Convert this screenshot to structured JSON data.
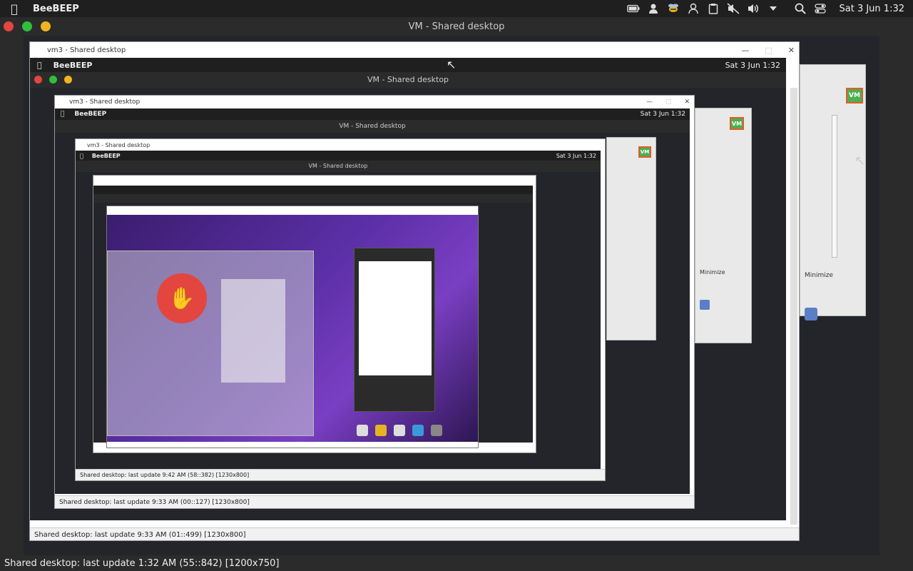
{
  "menubar": {
    "app_name": "BeeBEEP",
    "clock": "Sat 3 Jun 1:32",
    "tray_icons": [
      "battery-icon",
      "user-icon",
      "beebeep-icon",
      "users-icon",
      "clipboard-icon",
      "mute-icon",
      "volume-icon",
      "dropdown-icon",
      "search-icon",
      "toggle-icon"
    ]
  },
  "window": {
    "title": "VM - Shared desktop"
  },
  "level1": {
    "title": "vm3 - Shared desktop",
    "app_name": "BeeBEEP",
    "clock": "Sat 3 Jun 1:32",
    "inner_title": "VM - Shared desktop",
    "status": "Shared desktop: last update 9:33 AM (01::499) [1230x800]"
  },
  "level2": {
    "title": "vm3 - Shared desktop",
    "app_name": "BeeBEEP",
    "clock": "Sat 3 Jun 1:32",
    "inner_title": "VM - Shared desktop",
    "status": "Shared desktop: last update 9:33 AM (00::127) [1230x800]"
  },
  "level3": {
    "title": "vm3 - Shared desktop",
    "app_name": "BeeBEEP",
    "clock": "Sat 3 Jun 1:32",
    "inner_title": "VM - Shared desktop",
    "status": "Shared desktop: last update 9:42 AM (58::382) [1230x800]"
  },
  "side": {
    "vm_label": "VM",
    "minimize": "Minimize"
  },
  "status": {
    "text": "Shared desktop: last update 1:32 AM (55::842) [1200x750]"
  }
}
